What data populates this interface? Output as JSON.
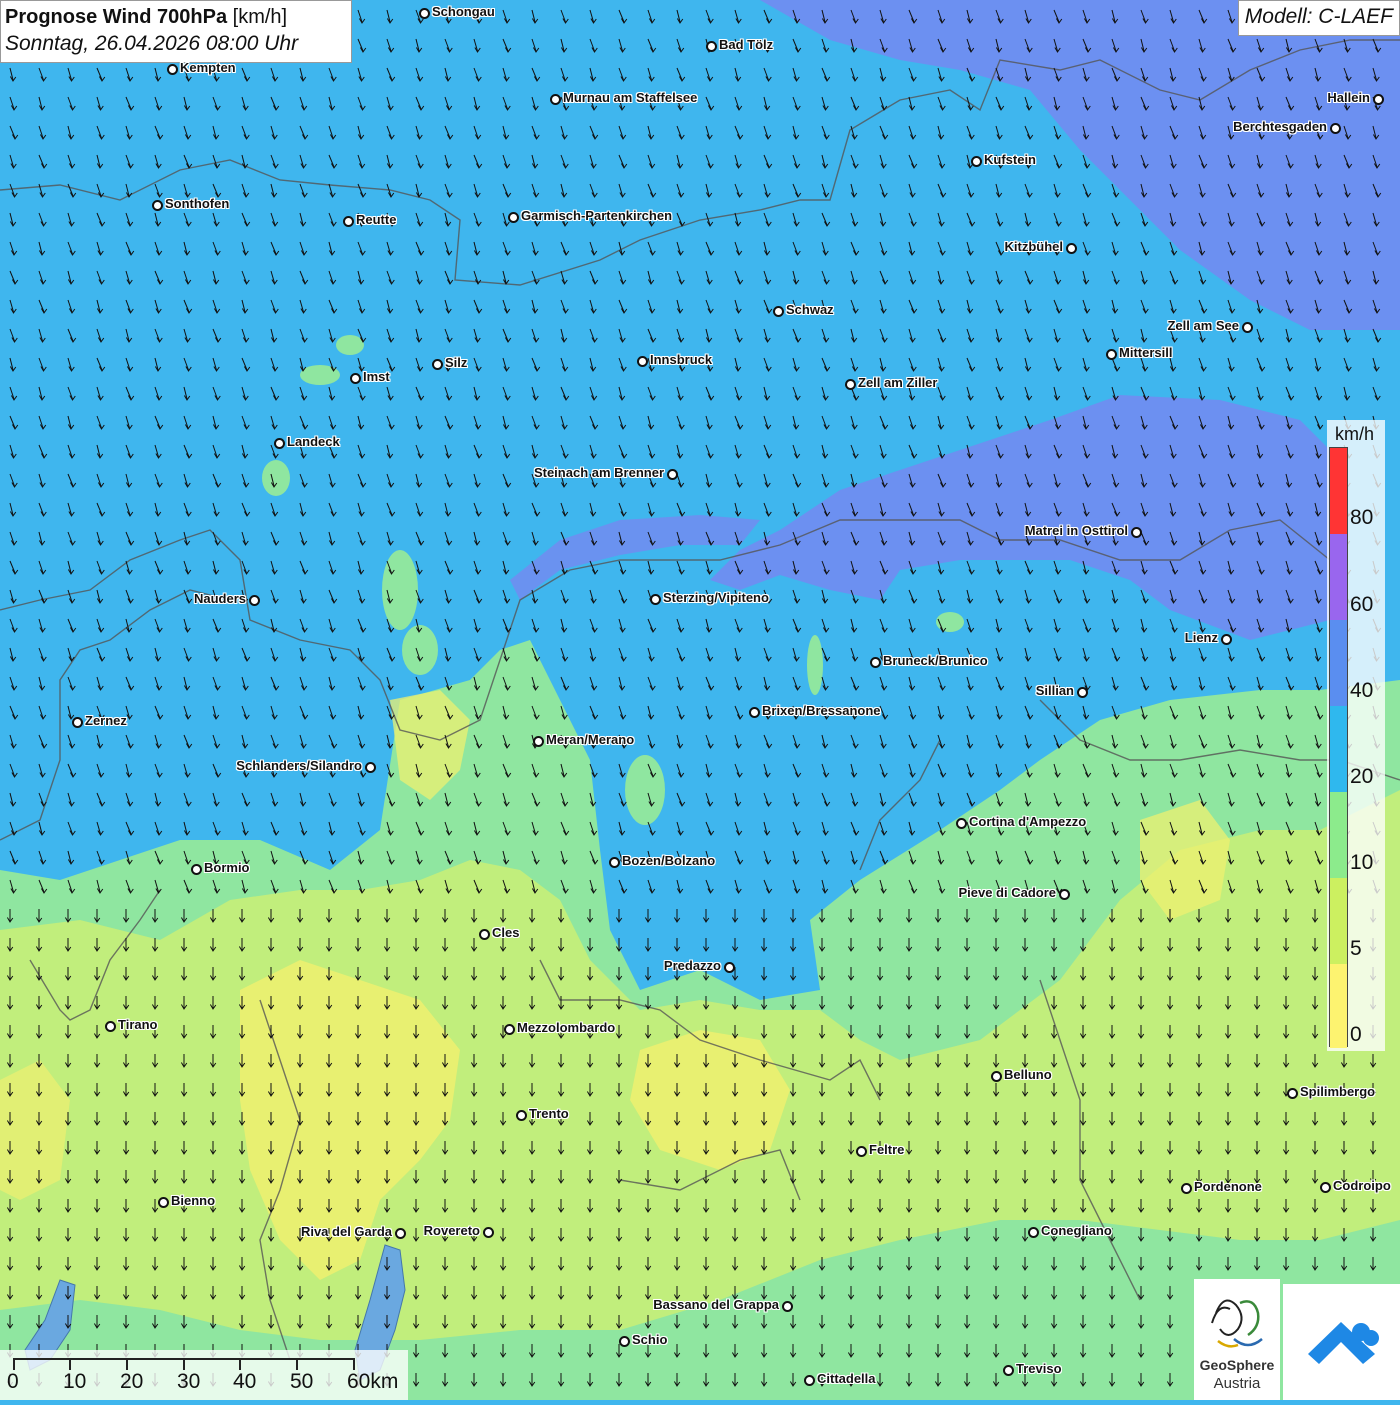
{
  "title": {
    "main": "Prognose Wind 700hPa",
    "unit": "[km/h]",
    "date": "Sonntag, 26.04.2026 08:00 Uhr"
  },
  "model": "Modell: C-LAEF",
  "legend": {
    "unit": "km/h",
    "ticks": [
      "80",
      "60",
      "40",
      "20",
      "10",
      "5",
      "0"
    ],
    "colors": [
      "#ff3434",
      "#9966ee",
      "#5a8ef0",
      "#2fb8ee",
      "#8ceb8c",
      "#ccf060",
      "#fdf370"
    ]
  },
  "scale_bar": {
    "labels": [
      "0",
      "10",
      "20",
      "30",
      "40",
      "50",
      "60km"
    ]
  },
  "logos": {
    "geosphere_name": "GeoSphere",
    "geosphere_sub": "Austria"
  },
  "colors": {
    "wind_20_40": "#3fb6ee",
    "wind_40_60": "#6f8ef0",
    "wind_60_80": "#8a78ec",
    "wind_10_20": "#8fe6a0",
    "wind_5_10": "#c6ee78",
    "wind_0_5": "#eef070",
    "arrows": "#111111",
    "borders": "#555555"
  },
  "cities": [
    {
      "name": "Schongau",
      "side": "right"
    },
    {
      "name": "Bad Tölz",
      "side": "right"
    },
    {
      "name": "Kempten",
      "side": "right"
    },
    {
      "name": "Hallein",
      "side": "left"
    },
    {
      "name": "Murnau am Staffelsee",
      "side": "right"
    },
    {
      "name": "Berchtesgaden",
      "side": "left"
    },
    {
      "name": "Kufstein",
      "side": "right"
    },
    {
      "name": "Sonthofen",
      "side": "right"
    },
    {
      "name": "Reutte",
      "side": "right"
    },
    {
      "name": "Garmisch-Partenkirchen",
      "side": "right"
    },
    {
      "name": "Kitzbühel",
      "side": "left"
    },
    {
      "name": "Schwaz",
      "side": "right"
    },
    {
      "name": "Zell am See",
      "side": "left"
    },
    {
      "name": "Innsbruck",
      "side": "right"
    },
    {
      "name": "Mittersill",
      "side": "right"
    },
    {
      "name": "Silz",
      "side": "right"
    },
    {
      "name": "Imst",
      "side": "right"
    },
    {
      "name": "Zell am Ziller",
      "side": "right"
    },
    {
      "name": "Landeck",
      "side": "right"
    },
    {
      "name": "Steinach am Brenner",
      "side": "left"
    },
    {
      "name": "Matrei in Osttirol",
      "side": "left"
    },
    {
      "name": "Nauders",
      "side": "left"
    },
    {
      "name": "Sterzing/Vipiteno",
      "side": "right"
    },
    {
      "name": "Lienz",
      "side": "left"
    },
    {
      "name": "Bruneck/Brunico",
      "side": "right"
    },
    {
      "name": "Sillian",
      "side": "left"
    },
    {
      "name": "Zernez",
      "side": "right"
    },
    {
      "name": "Brixen/Bressanone",
      "side": "right"
    },
    {
      "name": "Meran/Merano",
      "side": "right"
    },
    {
      "name": "Schlanders/Silandro",
      "side": "left"
    },
    {
      "name": "Cortina d'Ampezzo",
      "side": "right"
    },
    {
      "name": "Bozen/Bolzano",
      "side": "right"
    },
    {
      "name": "Bormio",
      "side": "right"
    },
    {
      "name": "Pieve di Cadore",
      "side": "left"
    },
    {
      "name": "Cles",
      "side": "right"
    },
    {
      "name": "Predazzo",
      "side": "left"
    },
    {
      "name": "Tirano",
      "side": "right"
    },
    {
      "name": "Mezzolombardo",
      "side": "right"
    },
    {
      "name": "Belluno",
      "side": "right"
    },
    {
      "name": "Spilimbergo",
      "side": "right"
    },
    {
      "name": "Trento",
      "side": "right"
    },
    {
      "name": "Feltre",
      "side": "right"
    },
    {
      "name": "Pordenone",
      "side": "right"
    },
    {
      "name": "Codroipo",
      "side": "right"
    },
    {
      "name": "Bienno",
      "side": "right"
    },
    {
      "name": "Riva del Garda",
      "side": "left"
    },
    {
      "name": "Rovereto",
      "side": "left"
    },
    {
      "name": "Conegliano",
      "side": "right"
    },
    {
      "name": "Bassano del Grappa",
      "side": "left"
    },
    {
      "name": "Schio",
      "side": "right"
    },
    {
      "name": "Treviso",
      "side": "right"
    },
    {
      "name": "Cittadella",
      "side": "right"
    }
  ]
}
